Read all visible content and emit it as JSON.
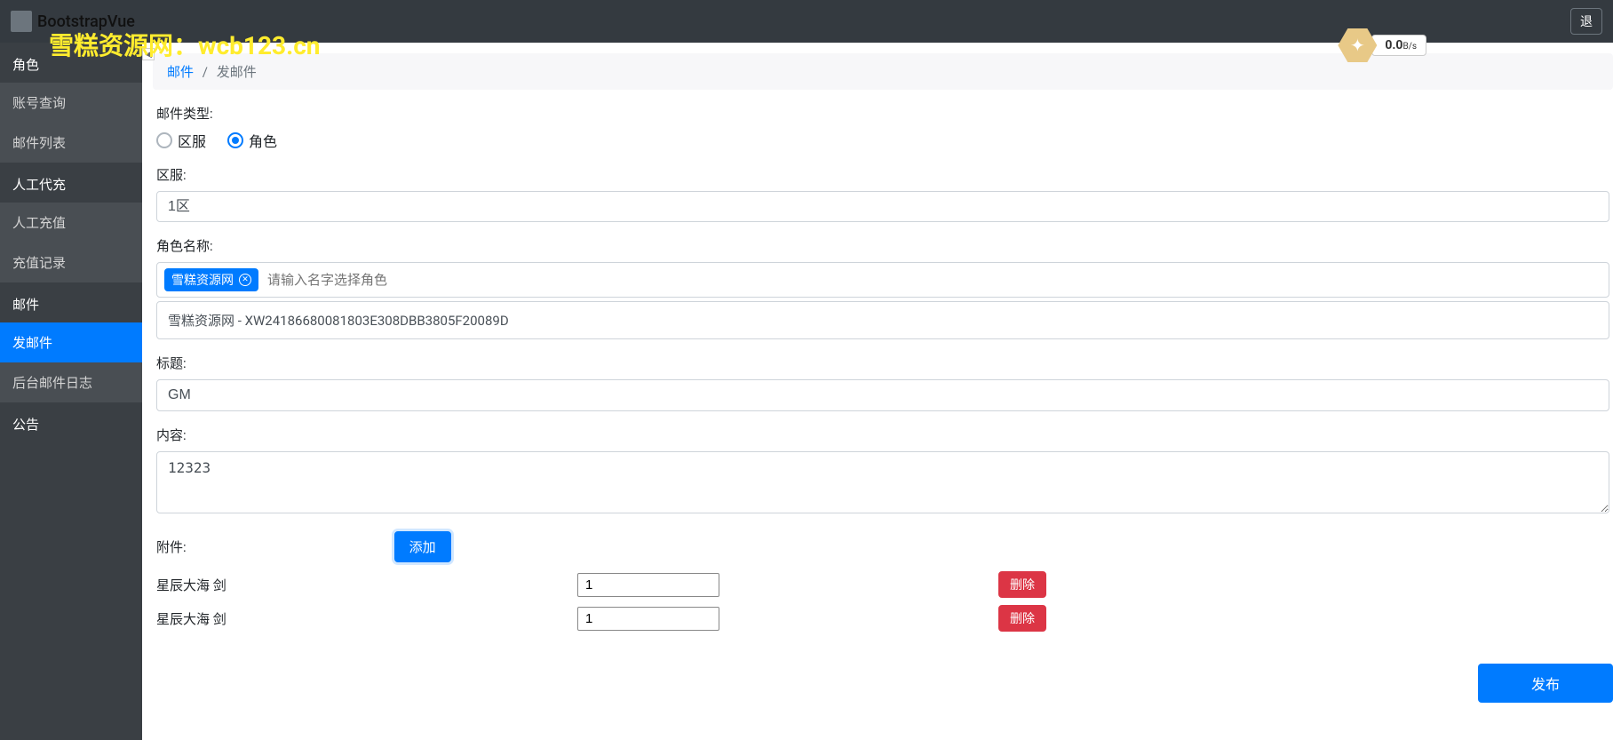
{
  "brand": "BootstrapVue",
  "watermark": "雪糕资源网：wcb123.cn",
  "logout": "退",
  "speed": {
    "value": "0.0",
    "unit": "B/s"
  },
  "sidebar": {
    "groups": [
      {
        "heading": "",
        "items": [
          "角色",
          "账号查询",
          "邮件列表"
        ]
      },
      {
        "heading": "",
        "items": [
          "人工代充",
          "人工充值",
          "充值记录"
        ]
      },
      {
        "heading": "",
        "items": [
          "邮件",
          "发邮件",
          "后台邮件日志"
        ]
      },
      {
        "heading": "",
        "items": [
          "公告"
        ]
      }
    ],
    "active": "发邮件"
  },
  "breadcrumb": {
    "parent": "邮件",
    "current": "发邮件"
  },
  "form": {
    "mail_type_label": "邮件类型:",
    "mail_type_options": [
      "区服",
      "角色"
    ],
    "mail_type_selected": "角色",
    "region_label": "区服:",
    "region_value": "1区",
    "role_name_label": "角色名称:",
    "role_tags": [
      "雪糕资源网"
    ],
    "role_search_placeholder": "请输入名字选择角色",
    "role_result": "雪糕资源网 - XW24186680081803E308DBB3805F20089D",
    "title_label": "标题:",
    "title_value": "GM",
    "content_label": "内容:",
    "content_value": "12323",
    "attachment_label": "附件:",
    "add_button": "添加",
    "delete_button": "删除",
    "attachments": [
      {
        "name": "星辰大海 剑",
        "qty": "1"
      },
      {
        "name": "星辰大海 剑",
        "qty": "1"
      }
    ],
    "publish_button": "发布"
  }
}
